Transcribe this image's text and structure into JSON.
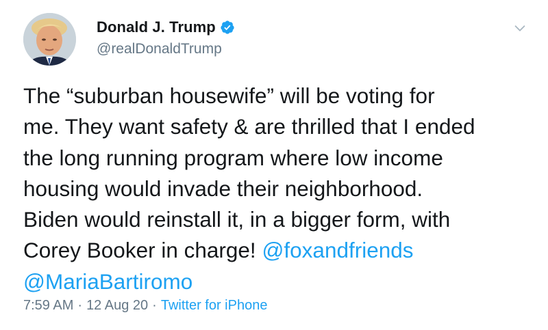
{
  "author": {
    "display_name": "Donald J. Trump",
    "handle": "@realDonaldTrump",
    "verified": true
  },
  "tweet": {
    "lines": [
      "The “suburban housewife” will be voting for",
      "me. They want safety & are thrilled that I ended",
      "the long running program where low income",
      "housing would invade their neighborhood.",
      "Biden would reinstall it, in a bigger form, with",
      "Corey Booker in charge! "
    ],
    "mention_1": "@foxandfriends",
    "mention_2": "@MariaBartiromo"
  },
  "meta": {
    "time": "7:59 AM",
    "separator": "·",
    "date": "12 Aug 20",
    "source": "Twitter for iPhone"
  },
  "colors": {
    "link_blue": "#1da1f2",
    "secondary_gray": "#657786",
    "text": "#14171a"
  },
  "icons": {
    "verified": "verified-badge-icon",
    "menu": "chevron-down-icon"
  }
}
